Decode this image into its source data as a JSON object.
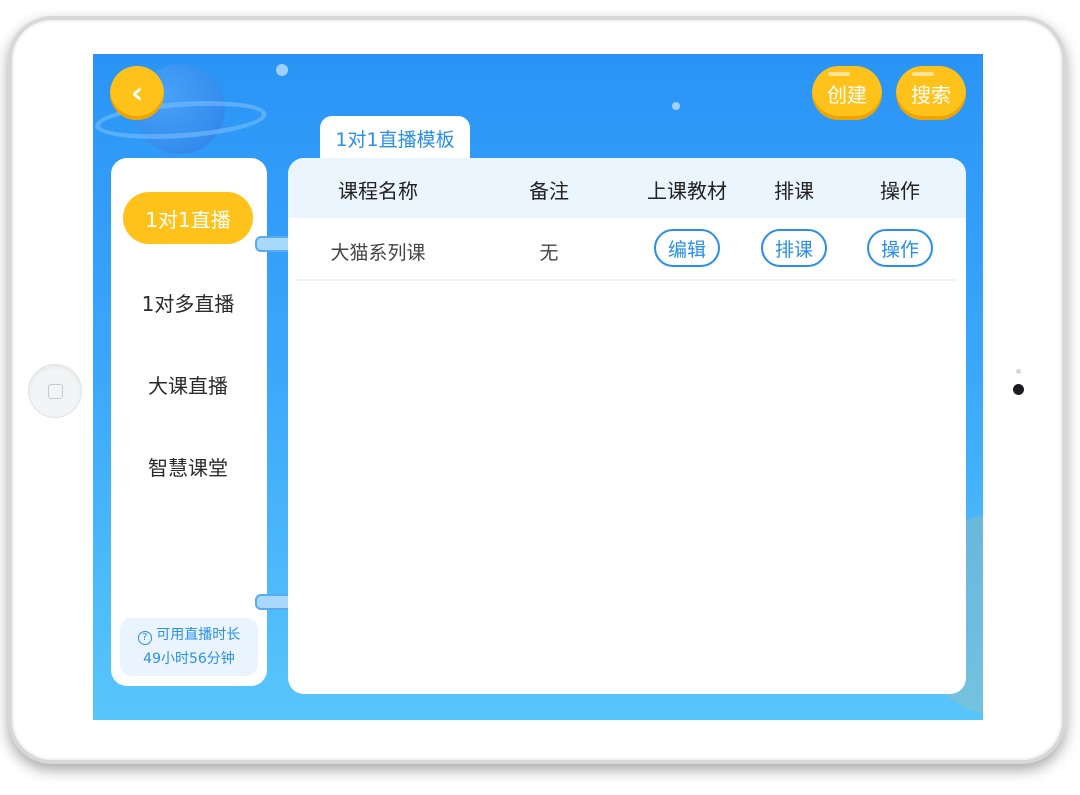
{
  "header": {
    "back_icon": "chevron-left-icon",
    "create_label": "创建",
    "search_label": "搜索"
  },
  "tab": {
    "label": "1对1直播模板"
  },
  "sidebar": {
    "items": [
      {
        "label": "1对1直播",
        "active": true
      },
      {
        "label": "1对多直播",
        "active": false
      },
      {
        "label": "大课直播",
        "active": false
      },
      {
        "label": "智慧课堂",
        "active": false
      }
    ],
    "duration": {
      "icon": "question-circle-icon",
      "title": "可用直播时长",
      "value": "49小时56分钟"
    }
  },
  "table": {
    "columns": [
      "课程名称",
      "备注",
      "上课教材",
      "排课",
      "操作"
    ],
    "rows": [
      {
        "course_name": "大猫系列课",
        "note": "无",
        "material_action": "编辑",
        "schedule_action": "排课",
        "operation_action": "操作"
      }
    ]
  },
  "colors": {
    "accent_yellow": "#ffc21a",
    "primary_blue": "#2a8fe8",
    "background_blue": "#2a94f6"
  }
}
